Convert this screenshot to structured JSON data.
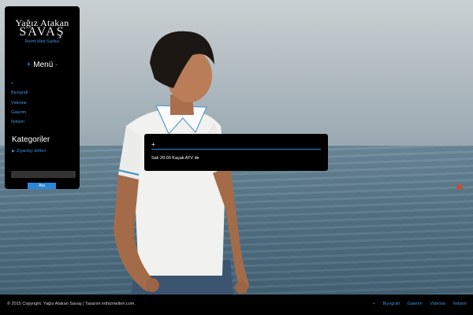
{
  "logo": {
    "line1": "Yağız Atakan",
    "line2": "SAVAŞ",
    "tagline": "Resmi Web Sayfası"
  },
  "menu": {
    "title_prefix": "+",
    "title": "Menü",
    "title_suffix": "-"
  },
  "nav": {
    "items": [
      {
        "label": "+"
      },
      {
        "label": "Biyografi"
      },
      {
        "label": "Videolar"
      },
      {
        "label": "Galerim"
      },
      {
        "label": "İletisim"
      }
    ]
  },
  "categories": {
    "title": "Kategoriler",
    "link": "Ziyaretçi defteri"
  },
  "search": {
    "placeholder": "",
    "button_label": "Ara"
  },
  "post": {
    "plus": "+",
    "text": "Salı 20:00 Kaçak ATV de"
  },
  "footer": {
    "copyright": "© 2015 Copyright. Yağız Atakan Savaş | Tasarım inthizmetleri.com.",
    "links": [
      {
        "label": "+"
      },
      {
        "label": "Biyografi"
      },
      {
        "label": "Galerim"
      },
      {
        "label": "Videolar"
      },
      {
        "label": "İletisim"
      }
    ]
  },
  "colors": {
    "accent": "#2a86d9",
    "link": "#3d8fd6",
    "panel_bg": "#000000"
  }
}
